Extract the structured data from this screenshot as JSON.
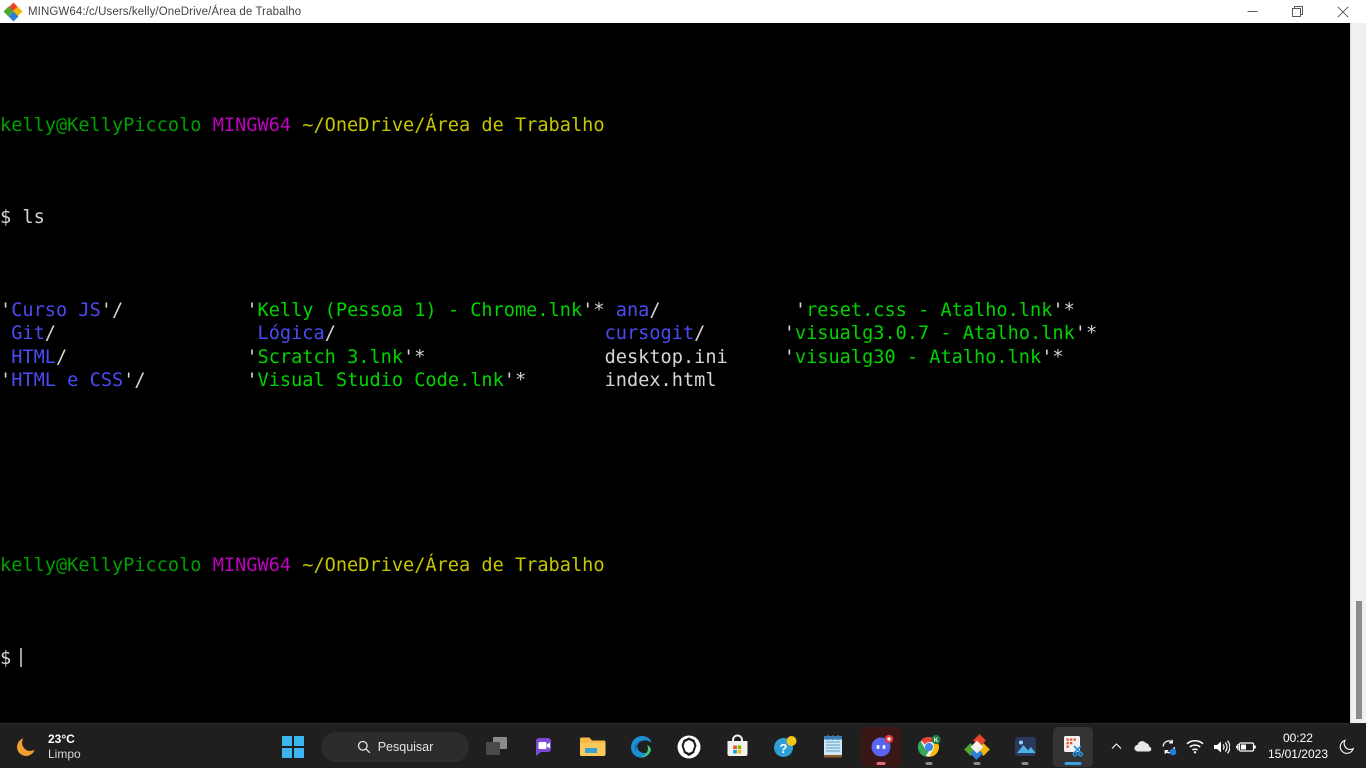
{
  "window": {
    "title": "MINGW64:/c/Users/kelly/OneDrive/Área de Trabalho",
    "icon_name": "git-bash-icon",
    "controls": {
      "minimize": "—",
      "maximize": "❐",
      "close": "✕"
    }
  },
  "terminal": {
    "prompt1": {
      "user_host": "kelly@KellyPiccolo",
      "shell": "MINGW64",
      "path": "~/OneDrive/Área de Trabalho"
    },
    "command_line": {
      "symbol": "$",
      "command": " ls"
    },
    "listing": {
      "columns": [
        {
          "rows": [
            {
              "quote_open": "'",
              "name": "Curso JS",
              "quote_close": "'",
              "suffix": "/",
              "type": "dir"
            },
            {
              "quote_open": " ",
              "name": "Git",
              "quote_close": "",
              "suffix": "/",
              "type": "dir"
            },
            {
              "quote_open": " ",
              "name": "HTML",
              "quote_close": "",
              "suffix": "/",
              "type": "dir"
            },
            {
              "quote_open": "'",
              "name": "HTML e CSS",
              "quote_close": "'",
              "suffix": "/",
              "type": "dir"
            }
          ]
        },
        {
          "rows": [
            {
              "quote_open": "'",
              "name": "Kelly (Pessoa 1) - Chrome.lnk",
              "quote_close": "'",
              "suffix": "*",
              "type": "exe"
            },
            {
              "quote_open": " ",
              "name": "Lógica",
              "quote_close": "",
              "suffix": "/",
              "type": "dir"
            },
            {
              "quote_open": "'",
              "name": "Scratch 3.lnk",
              "quote_close": "'",
              "suffix": "*",
              "type": "exe"
            },
            {
              "quote_open": "'",
              "name": "Visual Studio Code.lnk",
              "quote_close": "'",
              "suffix": "*",
              "type": "exe"
            }
          ]
        },
        {
          "rows": [
            {
              "quote_open": "",
              "name": "ana",
              "quote_close": "",
              "suffix": "/",
              "type": "dir"
            },
            {
              "quote_open": "",
              "name": "cursogit",
              "quote_close": "",
              "suffix": "/",
              "type": "dir"
            },
            {
              "quote_open": "",
              "name": "desktop.ini",
              "quote_close": "",
              "suffix": "",
              "type": "file"
            },
            {
              "quote_open": "",
              "name": "index.html",
              "quote_close": "",
              "suffix": "",
              "type": "file"
            }
          ]
        },
        {
          "rows": [
            {
              "quote_open": "'",
              "name": "reset.css - Atalho.lnk",
              "quote_close": "'",
              "suffix": "*",
              "type": "exe"
            },
            {
              "quote_open": "'",
              "name": "visualg3.0.7 - Atalho.lnk",
              "quote_close": "'",
              "suffix": "*",
              "type": "exe"
            },
            {
              "quote_open": "'",
              "name": "visualg30 - Atalho.lnk",
              "quote_close": "'",
              "suffix": "*",
              "type": "exe"
            },
            {
              "quote_open": "",
              "name": "",
              "quote_close": "",
              "suffix": "",
              "type": "file"
            }
          ]
        }
      ]
    },
    "prompt2": {
      "user_host": "kelly@KellyPiccolo",
      "shell": "MINGW64",
      "path": "~/OneDrive/Área de Trabalho"
    },
    "input_line": {
      "symbol": "$"
    },
    "colors": {
      "background": "#000000",
      "user_host": "#00a000",
      "shell": "#c000c0",
      "path": "#c7c700",
      "directory": "#4b4bf5",
      "executable": "#00d400",
      "plain": "#d6d6d6"
    }
  },
  "taskbar": {
    "weather": {
      "icon_name": "moon-icon",
      "temperature": "23°C",
      "condition": "Limpo"
    },
    "search": {
      "icon_name": "search-icon",
      "label": "Pesquisar"
    },
    "items": [
      {
        "name": "start-button",
        "label": "Iniciar"
      },
      {
        "name": "search-pill",
        "label": "Pesquisar"
      },
      {
        "name": "task-view-button",
        "label": "Visão de tarefas"
      },
      {
        "name": "chat-teams-button",
        "label": "Chat"
      },
      {
        "name": "file-explorer-button",
        "label": "Explorador de Arquivos"
      },
      {
        "name": "edge-button",
        "label": "Microsoft Edge"
      },
      {
        "name": "brave-button",
        "label": "Brave"
      },
      {
        "name": "microsoft-store-button",
        "label": "Microsoft Store"
      },
      {
        "name": "help-button",
        "label": "Obter Ajuda"
      },
      {
        "name": "notepad-button",
        "label": "Bloco de Notas"
      },
      {
        "name": "discord-button",
        "label": "Discord"
      },
      {
        "name": "chrome-button",
        "label": "Google Chrome"
      },
      {
        "name": "git-bash-button",
        "label": "Git Bash"
      },
      {
        "name": "photos-button",
        "label": "Fotos"
      },
      {
        "name": "snipping-tool-button",
        "label": "Ferramenta de Captura"
      }
    ],
    "tray": {
      "icons": [
        "chevron-up-icon",
        "onedrive-cloud-icon",
        "sync-icon",
        "wifi-icon",
        "volume-icon",
        "battery-charging-icon"
      ],
      "clock_time": "00:22",
      "clock_date": "15/01/2023",
      "notification_icon": "do-not-disturb-moon-icon"
    }
  }
}
